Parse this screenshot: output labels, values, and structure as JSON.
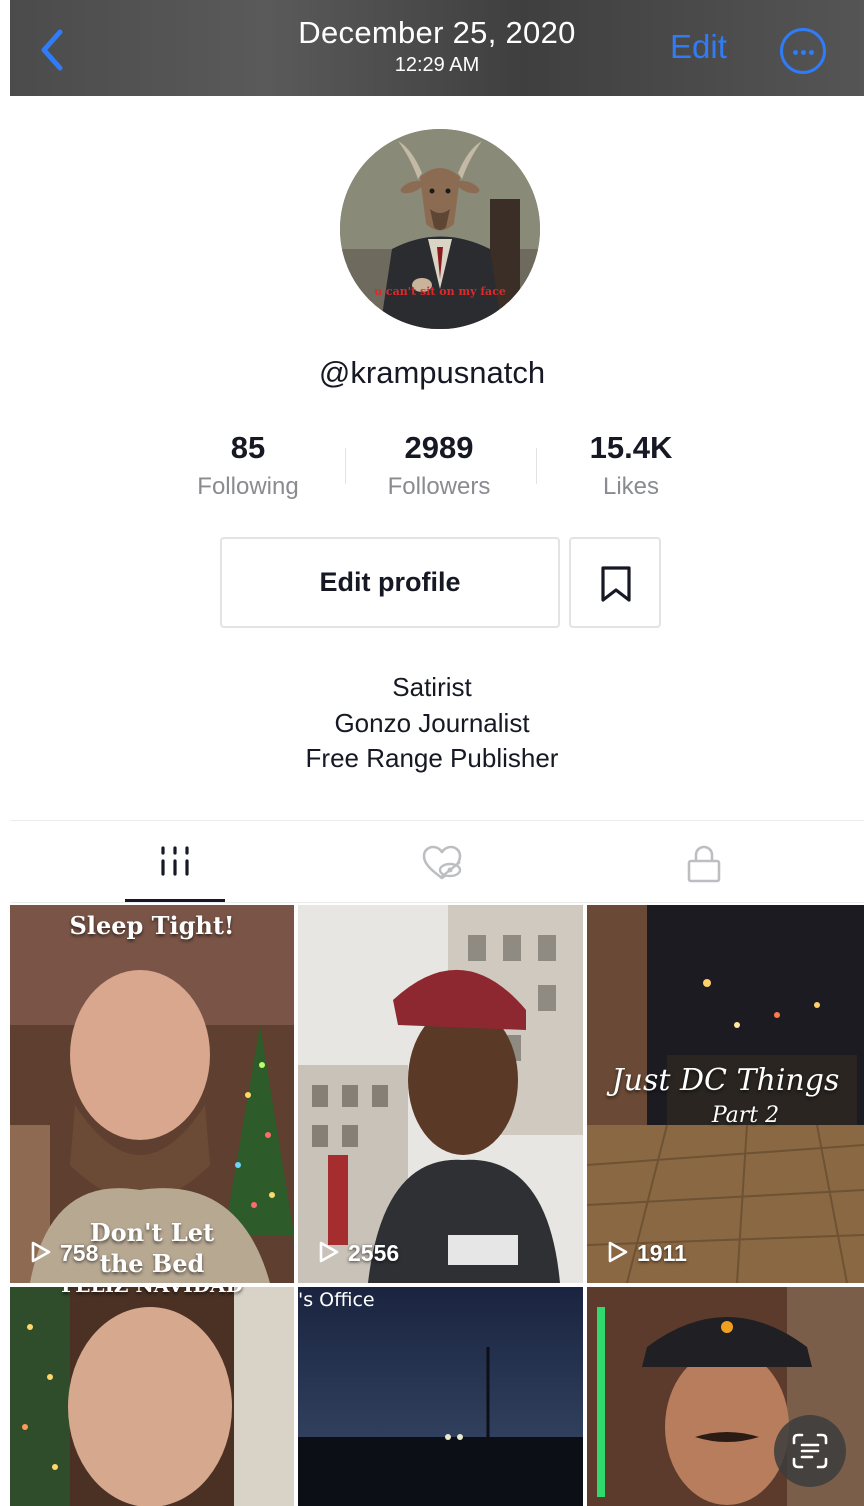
{
  "header": {
    "date": "December 25, 2020",
    "time": "12:29 AM",
    "edit_label": "Edit",
    "back_icon": "chevron-left-icon",
    "more_icon": "ellipsis-circle-icon",
    "accent_color": "#2f7cf6"
  },
  "profile": {
    "avatar_caption": "u can't sit on my face",
    "username": "@krampusnatch",
    "stats": [
      {
        "value": "85",
        "label": "Following"
      },
      {
        "value": "2989",
        "label": "Followers"
      },
      {
        "value": "15.4K",
        "label": "Likes"
      }
    ],
    "edit_profile_label": "Edit profile",
    "bookmark_icon": "bookmark-icon",
    "bio": [
      "Satirist",
      "Gonzo Journalist",
      "Free Range Publisher"
    ]
  },
  "tabs": [
    {
      "icon": "grid-icon",
      "active": true
    },
    {
      "icon": "liked-hidden-icon",
      "active": false
    },
    {
      "icon": "lock-icon",
      "active": false
    }
  ],
  "videos": [
    {
      "caption_top": "Sleep Tight!",
      "caption_bottom": "Don't Let the Bed Bugs Bite!",
      "plays": "758"
    },
    {
      "plays": "2556"
    },
    {
      "caption_line1": "Just DC Things",
      "caption_line2": "Part 2",
      "plays": "1911"
    },
    {
      "caption_top": "FELIZ NAVIDAD"
    },
    {
      "caption_top": "'s Office"
    },
    {}
  ],
  "scan_icon": "text-scan-icon"
}
